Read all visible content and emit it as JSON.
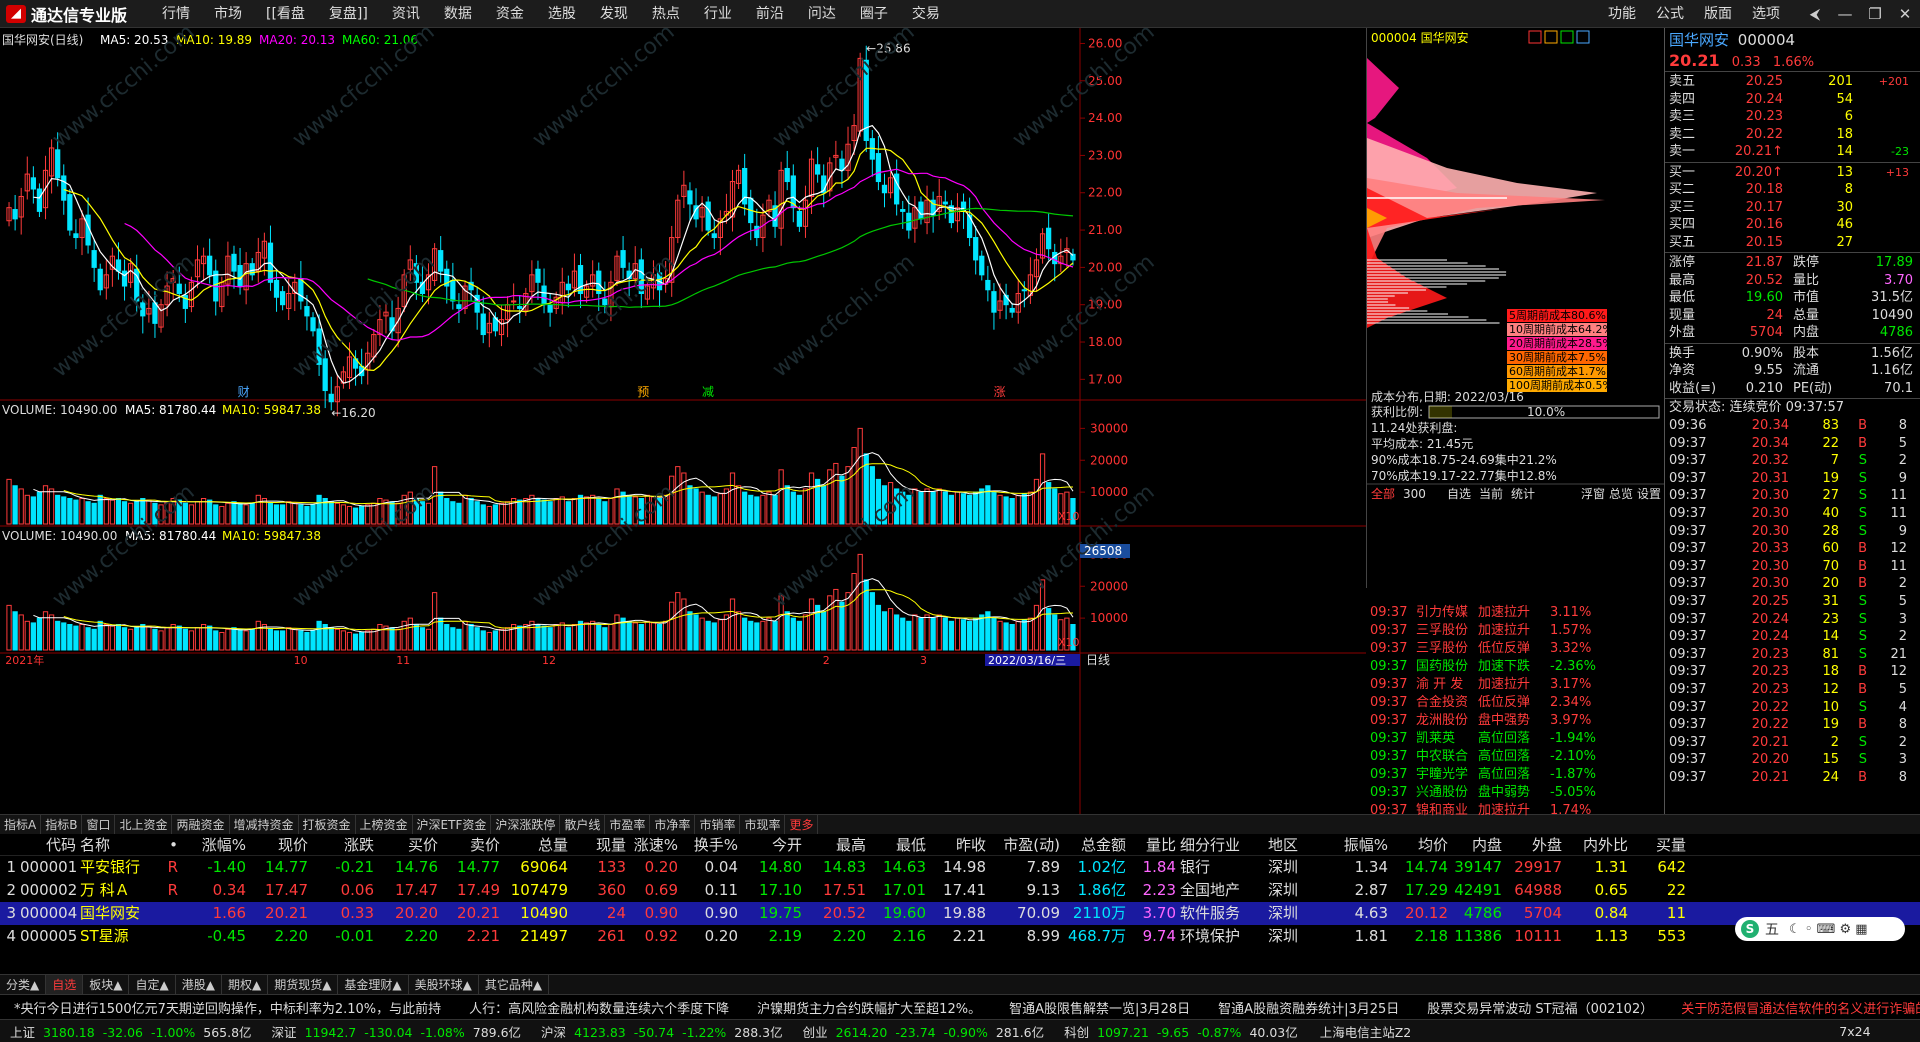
{
  "app": {
    "logo_text": "通达信专业版"
  },
  "menu": [
    "行情",
    "市场",
    "[[看盘",
    "复盘]]",
    "资讯",
    "数据",
    "资金",
    "选股",
    "发现",
    "热点",
    "行业",
    "前沿",
    "问达",
    "圈子",
    "交易"
  ],
  "right_menu": [
    "功能",
    "公式",
    "版面",
    "选项"
  ],
  "window_buttons": [
    "⮜",
    "—",
    "❐",
    "✕"
  ],
  "chart_data": [
    {
      "type": "candlestick",
      "title": "国华网安(日线)",
      "ma_labels": [
        "MA5: 20.53",
        "MA10: 19.89",
        "MA20: 20.13",
        "MA60: 21.06"
      ],
      "ylim": [
        16.5,
        26.2
      ],
      "yticks": [
        "26.00",
        "25.00",
        "24.00",
        "23.00",
        "22.00",
        "21.00",
        "20.00",
        "19.00",
        "18.00",
        "17.00"
      ],
      "high_label": "25.86",
      "low_label": "←16.20",
      "markers": [
        "财",
        "预",
        "减",
        "涨"
      ],
      "x_ticks": [
        "2021年",
        "10",
        "11",
        "12",
        "2",
        "3"
      ],
      "date_label": "2022/03/16/三",
      "period": "日线",
      "closes": [
        21.6,
        21.3,
        21.9,
        22.5,
        22.1,
        21.5,
        22.6,
        23.2,
        22.4,
        21.8,
        21.0,
        20.8,
        21.3,
        20.6,
        20.0,
        19.4,
        19.8,
        20.3,
        19.9,
        19.5,
        20.1,
        19.1,
        18.7,
        18.9,
        18.5,
        19.0,
        19.5,
        19.7,
        19.3,
        18.9,
        19.6,
        20.2,
        20.3,
        19.8,
        19.1,
        19.6,
        20.3,
        19.9,
        19.5,
        20.1,
        19.8,
        20.4,
        20.7,
        19.6,
        19.2,
        19.0,
        19.3,
        19.6,
        19.1,
        18.7,
        18.3,
        17.4,
        16.7,
        16.4,
        16.8,
        17.2,
        17.6,
        17.3,
        17.1,
        17.7,
        18.2,
        18.6,
        18.8,
        18.3,
        18.9,
        19.8,
        20.2,
        19.6,
        19.3,
        19.8,
        20.5,
        19.9,
        19.5,
        19.1,
        18.9,
        19.5,
        19.4,
        18.8,
        18.2,
        18.5,
        18.3,
        18.6,
        19.0,
        19.1,
        18.9,
        19.3,
        19.8,
        19.6,
        19.0,
        18.8,
        19.2,
        19.6,
        19.4,
        19.9,
        19.3,
        19.5,
        19.8,
        19.3,
        19.0,
        19.6,
        20.3,
        20.0,
        19.7,
        20.1,
        19.3,
        19.5,
        19.8,
        19.4,
        19.7,
        20.8,
        21.8,
        22.2,
        21.7,
        21.3,
        21.6,
        21.0,
        20.8,
        21.3,
        21.5,
        22.3,
        22.6,
        21.7,
        21.2,
        20.8,
        21.4,
        21.8,
        21.1,
        22.6,
        22.3,
        21.6,
        21.1,
        21.8,
        22.9,
        22.5,
        22.0,
        22.8,
        23.0,
        22.6,
        23.3,
        23.8,
        25.6,
        23.4,
        22.9,
        22.3,
        22.0,
        22.4,
        21.7,
        21.5,
        21.0,
        21.6,
        21.3,
        21.8,
        21.4,
        21.9,
        21.7,
        21.2,
        21.6,
        21.5,
        20.8,
        20.2,
        19.8,
        19.4,
        18.8,
        19.1,
        19.0,
        18.8,
        19.3,
        19.4,
        19.8,
        20.2,
        20.9,
        20.5,
        20.1,
        20.3,
        20.5,
        20.2
      ],
      "volumes": [
        14000,
        12000,
        11000,
        9000,
        8500,
        10000,
        12000,
        11000,
        9000,
        8500,
        8000,
        7500,
        8000,
        7000,
        6500,
        9000,
        8000,
        7500,
        8000,
        7000,
        6500,
        7000,
        8000,
        7500,
        6500,
        6000,
        7000,
        8000,
        7500,
        6500,
        6000,
        7000,
        8000,
        7500,
        6000,
        5500,
        6500,
        7000,
        6500,
        6000,
        6500,
        9000,
        8000,
        6500,
        6000,
        6000,
        7000,
        6500,
        6000,
        5500,
        6000,
        9000,
        8000,
        7000,
        6500,
        6000,
        5500,
        5000,
        5500,
        6000,
        6500,
        8000,
        7500,
        7000,
        6500,
        9000,
        10000,
        8000,
        7000,
        6500,
        18000,
        10000,
        8000,
        7000,
        6500,
        9000,
        8000,
        7000,
        6000,
        5500,
        6000,
        6500,
        7000,
        8000,
        7500,
        8000,
        9000,
        8000,
        7500,
        7000,
        8000,
        8500,
        7000,
        8000,
        9000,
        8500,
        9000,
        8000,
        7000,
        8000,
        11000,
        10000,
        9000,
        8500,
        8000,
        9000,
        8500,
        8000,
        9000,
        15000,
        18000,
        16000,
        12000,
        11000,
        10000,
        9000,
        8500,
        9500,
        11000,
        16000,
        12000,
        10000,
        9000,
        8500,
        9000,
        10000,
        9000,
        17000,
        12000,
        10000,
        9000,
        11000,
        16000,
        14000,
        12000,
        17000,
        19000,
        15000,
        18000,
        24000,
        30000,
        22000,
        18000,
        14000,
        12000,
        13000,
        11000,
        10000,
        9000,
        11000,
        10000,
        11000,
        10000,
        11000,
        10000,
        9000,
        10000,
        9500,
        9000,
        10000,
        11000,
        12000,
        10000,
        9000,
        8500,
        8000,
        9000,
        9500,
        10000,
        14000,
        22000,
        13000,
        11000,
        9500,
        10000,
        8000
      ]
    },
    {
      "type": "bar",
      "title": "VOLUME: 10490.00",
      "ma_labels": [
        "MA5: 81780.44",
        "MA10: 59847.38"
      ],
      "yticks": [
        "30000",
        "20000",
        "10000"
      ],
      "unit_label": "X10"
    },
    {
      "type": "bar",
      "title": "VOLUME: 10490.00",
      "ma_labels": [
        "MA5: 81780.44",
        "MA10: 59847.38"
      ],
      "yticks": [
        "30000",
        "20000",
        "10000"
      ],
      "unit_label": "X10",
      "current_label": "26508"
    }
  ],
  "cost": {
    "code": "000004",
    "name": "国华网安",
    "legend": [
      {
        "label": "5周期前成本80.6%",
        "color": "#ff1a1a"
      },
      {
        "label": "10周期前成本64.2%",
        "color": "#ff8080"
      },
      {
        "label": "20周期前成本28.5%",
        "color": "#ff1a8c"
      },
      {
        "label": "30周期前成本7.5%",
        "color": "#ff6600"
      },
      {
        "label": "60周期前成本1.7%",
        "color": "#ff9900"
      },
      {
        "label": "100周期前成本0.5%",
        "color": "#ffaa00"
      }
    ],
    "date_line": "成本分布,日期: 2022/03/16",
    "ratio_label": "获利比例:",
    "ratio_value": "10.0%",
    "ratio": 0.1,
    "lines": [
      "11.24处获利盘:",
      "平均成本: 21.45元",
      "90%成本18.75-24.69集中21.2%",
      "70%成本19.17-22.77集中12.8%"
    ]
  },
  "alerts": {
    "tabs": [
      "全部",
      "300",
      "自选",
      "当前",
      "统计"
    ],
    "right_tabs": [
      "浮窗",
      "总览",
      "设置"
    ],
    "items": [
      {
        "time": "09:37",
        "name": "引力传媒",
        "type": "加速拉升",
        "pct": "3.11%",
        "up": true
      },
      {
        "time": "09:37",
        "name": "三孚股份",
        "type": "加速拉升",
        "pct": "1.57%",
        "up": true
      },
      {
        "time": "09:37",
        "name": "三孚股份",
        "type": "低位反弹",
        "pct": "3.32%",
        "up": true
      },
      {
        "time": "09:37",
        "name": "国药股份",
        "type": "加速下跌",
        "pct": "-2.36%",
        "up": false
      },
      {
        "time": "09:37",
        "name": "渝 开 发",
        "type": "加速拉升",
        "pct": "3.17%",
        "up": true
      },
      {
        "time": "09:37",
        "name": "合金投资",
        "type": "低位反弹",
        "pct": "2.34%",
        "up": true
      },
      {
        "time": "09:37",
        "name": "龙洲股份",
        "type": "盘中强势",
        "pct": "3.97%",
        "up": true
      },
      {
        "time": "09:37",
        "name": "凯莱英",
        "type": "高位回落",
        "pct": "-1.94%",
        "up": false
      },
      {
        "time": "09:37",
        "name": "中农联合",
        "type": "高位回落",
        "pct": "-2.10%",
        "up": false
      },
      {
        "time": "09:37",
        "name": "宇瞳光学",
        "type": "高位回落",
        "pct": "-1.87%",
        "up": false
      },
      {
        "time": "09:37",
        "name": "兴通股份",
        "type": "盘中弱势",
        "pct": "-5.05%",
        "up": false
      },
      {
        "time": "09:37",
        "name": "锦和商业",
        "type": "加速拉升",
        "pct": "1.74%",
        "up": true
      }
    ]
  },
  "quote": {
    "name": "国华网安",
    "code": "000004",
    "price": "20.21",
    "chg": "0.33",
    "pct": "1.66%",
    "asks": [
      {
        "l": "卖五",
        "p": "20.25",
        "v": "201",
        "x": "+201"
      },
      {
        "l": "卖四",
        "p": "20.24",
        "v": "54",
        "x": ""
      },
      {
        "l": "卖三",
        "p": "20.23",
        "v": "6",
        "x": ""
      },
      {
        "l": "卖二",
        "p": "20.22",
        "v": "18",
        "x": ""
      },
      {
        "l": "卖一",
        "p": "20.21↑",
        "v": "14",
        "x": "-23"
      }
    ],
    "bids": [
      {
        "l": "买一",
        "p": "20.20↑",
        "v": "13",
        "x": "+13"
      },
      {
        "l": "买二",
        "p": "20.18",
        "v": "8",
        "x": ""
      },
      {
        "l": "买三",
        "p": "20.17",
        "v": "30",
        "x": ""
      },
      {
        "l": "买四",
        "p": "20.16",
        "v": "46",
        "x": ""
      },
      {
        "l": "买五",
        "p": "20.15",
        "v": "27",
        "x": ""
      }
    ],
    "stats": [
      [
        "涨停",
        "21.87",
        "red",
        "跌停",
        "17.89",
        "green"
      ],
      [
        "最高",
        "20.52",
        "red",
        "量比",
        "3.70",
        "purple"
      ],
      [
        "最低",
        "19.60",
        "green",
        "市值",
        "31.5亿",
        "white"
      ],
      [
        "现量",
        "24",
        "red",
        "总量",
        "10490",
        "white"
      ],
      [
        "外盘",
        "5704",
        "red",
        "内盘",
        "4786",
        "green"
      ]
    ],
    "stats2": [
      [
        "换手",
        "0.90%",
        "股本",
        "1.56亿"
      ],
      [
        "净资",
        "9.55",
        "流通",
        "1.16亿"
      ],
      [
        "收益(≡)",
        "0.210",
        "PE(动)",
        "70.1"
      ]
    ],
    "ticks_title": "交易状态: 连续竞价 09:37:57",
    "ticks": [
      [
        "09:36",
        "20.34",
        "83",
        "B",
        "8"
      ],
      [
        "09:37",
        "20.34",
        "22",
        "B",
        "5"
      ],
      [
        "09:37",
        "20.32",
        "7",
        "S",
        "2"
      ],
      [
        "09:37",
        "20.31",
        "19",
        "S",
        "9"
      ],
      [
        "09:37",
        "20.30",
        "27",
        "S",
        "11"
      ],
      [
        "09:37",
        "20.30",
        "40",
        "S",
        "11"
      ],
      [
        "09:37",
        "20.30",
        "28",
        "S",
        "9"
      ],
      [
        "09:37",
        "20.33",
        "60",
        "B",
        "12"
      ],
      [
        "09:37",
        "20.30",
        "70",
        "B",
        "11"
      ],
      [
        "09:37",
        "20.30",
        "20",
        "B",
        "2"
      ],
      [
        "09:37",
        "20.25",
        "31",
        "S",
        "5"
      ],
      [
        "09:37",
        "20.24",
        "23",
        "S",
        "3"
      ],
      [
        "09:37",
        "20.24",
        "14",
        "S",
        "2"
      ],
      [
        "09:37",
        "20.23",
        "81",
        "S",
        "21"
      ],
      [
        "09:37",
        "20.23",
        "18",
        "B",
        "12"
      ],
      [
        "09:37",
        "20.23",
        "12",
        "B",
        "5"
      ],
      [
        "09:37",
        "20.22",
        "10",
        "S",
        "4"
      ],
      [
        "09:37",
        "20.22",
        "19",
        "B",
        "8"
      ],
      [
        "09:37",
        "20.21",
        "2",
        "S",
        "2"
      ],
      [
        "09:37",
        "20.20",
        "15",
        "S",
        "3"
      ],
      [
        "09:37",
        "20.21",
        "24",
        "B",
        "8"
      ]
    ]
  },
  "tabs1": [
    "指标A",
    "指标B",
    "窗口",
    "北上资金",
    "两融资金",
    "增减持资金",
    "打板资金",
    "上榜资金",
    "沪深ETF资金",
    "沪深涨跌停",
    "散户线",
    "市盈率",
    "市净率",
    "市销率",
    "市现率",
    "更多"
  ],
  "table": {
    "headers": [
      "",
      "代码",
      "名称",
      "•",
      "涨幅%",
      "现价",
      "涨跌",
      "买价",
      "卖价",
      "总量",
      "现量",
      "涨速%",
      "换手%",
      "今开",
      "最高",
      "最低",
      "昨收",
      "市盈(动)",
      "总金额",
      "量比",
      "细分行业",
      "地区",
      "振幅%",
      "均价",
      "内盘",
      "外盘",
      "内外比",
      "买量"
    ],
    "rows": [
      [
        "1",
        "000001",
        "平安银行",
        "R",
        "-1.40",
        "14.77",
        "-0.21",
        "14.76",
        "14.77",
        "69064",
        "133",
        "0.20",
        "0.04",
        "14.80",
        "14.83",
        "14.63",
        "14.98",
        "7.89",
        "1.02亿",
        "1.84",
        "银行",
        "深圳",
        "1.34",
        "14.74",
        "39147",
        "29917",
        "1.31",
        "642"
      ],
      [
        "2",
        "000002",
        "万 科Ａ",
        "R",
        "0.34",
        "17.47",
        "0.06",
        "17.47",
        "17.49",
        "107479",
        "360",
        "0.69",
        "0.11",
        "17.10",
        "17.51",
        "17.01",
        "17.41",
        "9.13",
        "1.86亿",
        "2.23",
        "全国地产",
        "深圳",
        "2.87",
        "17.29",
        "42491",
        "64988",
        "0.65",
        "22"
      ],
      [
        "3",
        "000004",
        "国华网安",
        "",
        "1.66",
        "20.21",
        "0.33",
        "20.20",
        "20.21",
        "10490",
        "24",
        "0.90",
        "0.90",
        "19.75",
        "20.52",
        "19.60",
        "19.88",
        "70.09",
        "2110万",
        "3.70",
        "软件服务",
        "深圳",
        "4.63",
        "20.12",
        "4786",
        "5704",
        "0.84",
        "11"
      ],
      [
        "4",
        "000005",
        "ST星源",
        "",
        "-0.45",
        "2.20",
        "-0.01",
        "2.20",
        "2.21",
        "21497",
        "261",
        "0.92",
        "0.20",
        "2.19",
        "2.20",
        "2.16",
        "2.21",
        "8.99",
        "468.7万",
        "9.74",
        "环境保护",
        "深圳",
        "1.81",
        "2.18",
        "11386",
        "10111",
        "1.13",
        "553"
      ]
    ]
  },
  "tabs2": [
    "分类▲",
    "自选",
    "板块▲",
    "自定▲",
    "港股▲",
    "期权▲",
    "期货现货▲",
    "基金理财▲",
    "美股环球▲",
    "其它品种▲"
  ],
  "news": [
    "*央行今日进行1500亿元7天期逆回购操作，中标利率为2.10%，与此前持",
    "人行：高风险金融机构数量连续六个季度下降",
    "沪镍期货主力合约跌幅扩大至超12%。",
    "智通A股限售解禁一览|3月28日",
    "智通A股融资融券统计|3月25日",
    "股票交易异常波动 ST冠福（002102）",
    "关于防范假冒通达信软件的名义进行诈骗的安全公告"
  ],
  "status": {
    "items": [
      {
        "name": "上证",
        "v": "3180.18",
        "c": "-32.06",
        "p": "-1.00%",
        "a": "565.8亿"
      },
      {
        "name": "深证",
        "v": "11942.7",
        "c": "-130.04",
        "p": "-1.08%",
        "a": "789.6亿"
      },
      {
        "name": "沪深",
        "v": "4123.83",
        "c": "-50.74",
        "p": "-1.22%",
        "a": "288.3亿"
      },
      {
        "name": "创业",
        "v": "2614.20",
        "c": "-23.74",
        "p": "-0.90%",
        "a": "281.6亿"
      },
      {
        "name": "科创",
        "v": "1097.21",
        "c": "-9.65",
        "p": "-0.87%",
        "a": "40.03亿"
      }
    ],
    "server": "上海电信主站Z2",
    "time": "7x24"
  },
  "ime": {
    "label": "五"
  },
  "watermark": "www.cfcchi.com"
}
